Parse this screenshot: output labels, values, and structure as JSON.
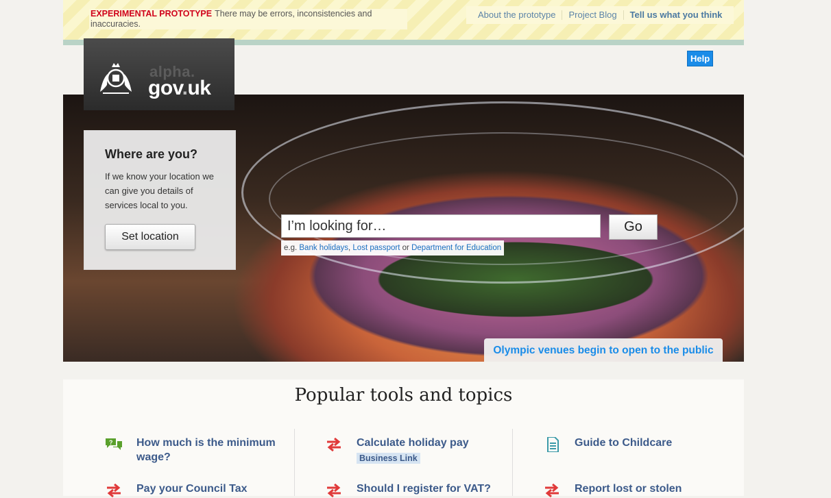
{
  "banner": {
    "warning": "EXPERIMENTAL PROTOTYPE",
    "message": "There may be errors, inconsistencies and inaccuracies.",
    "links": [
      "About the prototype",
      "Project Blog",
      "Tell us what you think"
    ]
  },
  "logo": {
    "alpha": "alpha.",
    "gov": "gov",
    "dot": ".",
    "uk": "uk"
  },
  "help_label": "Help",
  "location": {
    "title": "Where are you?",
    "body": "If we know your location we can give you details of services local to you.",
    "button": "Set location"
  },
  "search": {
    "placeholder": "I’m looking for…",
    "go_label": "Go",
    "eg_prefix": "e.g.",
    "examples": [
      "Bank holidays",
      "Lost passport",
      "Department for Education"
    ],
    "sep_comma": ",",
    "sep_or": "or"
  },
  "feature_link": "Olympic venues begin to open to the public",
  "popular": {
    "title": "Popular tools and topics",
    "items": [
      {
        "label": "How much is the minimum wage?",
        "icon": "speech-bubble-icon",
        "color": "#5aa02c"
      },
      {
        "label": "Calculate holiday pay",
        "badge": "Business Link",
        "icon": "exchange-arrows-icon",
        "color": "#e03a3a"
      },
      {
        "label": "Guide to Childcare",
        "icon": "document-icon",
        "color": "#3a9aa8"
      },
      {
        "label": "Pay your Council Tax",
        "icon": "exchange-arrows-icon",
        "color": "#e03a3a"
      },
      {
        "label": "Should I register for VAT?",
        "icon": "exchange-arrows-icon",
        "color": "#e03a3a"
      },
      {
        "label": "Report lost or stolen",
        "icon": "exchange-arrows-icon",
        "color": "#e03a3a"
      }
    ]
  },
  "colors": {
    "accent": "#1a8ce8",
    "link": "#3c5a8a",
    "warning": "#d0021b"
  }
}
